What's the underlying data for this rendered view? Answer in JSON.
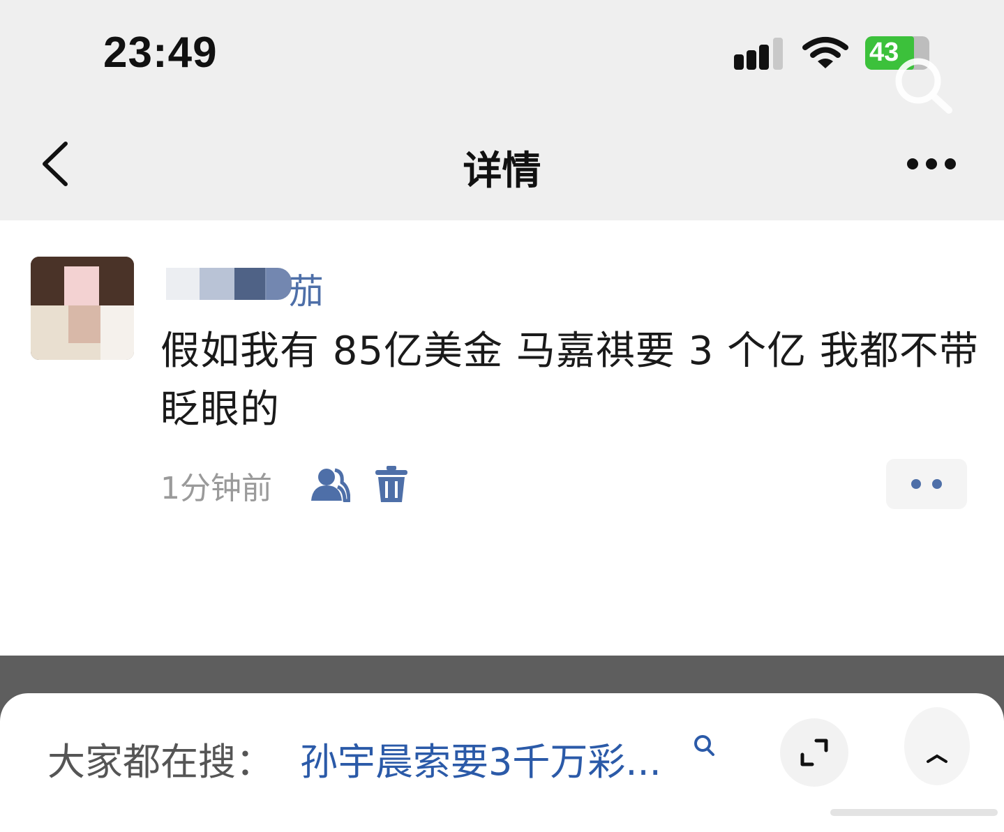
{
  "status_bar": {
    "time": "23:49",
    "battery": "43"
  },
  "nav": {
    "title": "详情"
  },
  "post": {
    "author_visible_part": "茄",
    "text": "假如我有 85亿美金 马嘉祺要 3 个亿 我都不带眨眼的",
    "time": "1分钟前"
  },
  "bottom_sheet": {
    "trending_label": "大家都在搜：",
    "trending_query": "孙宇晨索要3千万彩..."
  },
  "colors": {
    "link_blue": "#2b5aa8",
    "accent_blue": "#4e6fa8",
    "battery_green": "#3cc13b"
  }
}
